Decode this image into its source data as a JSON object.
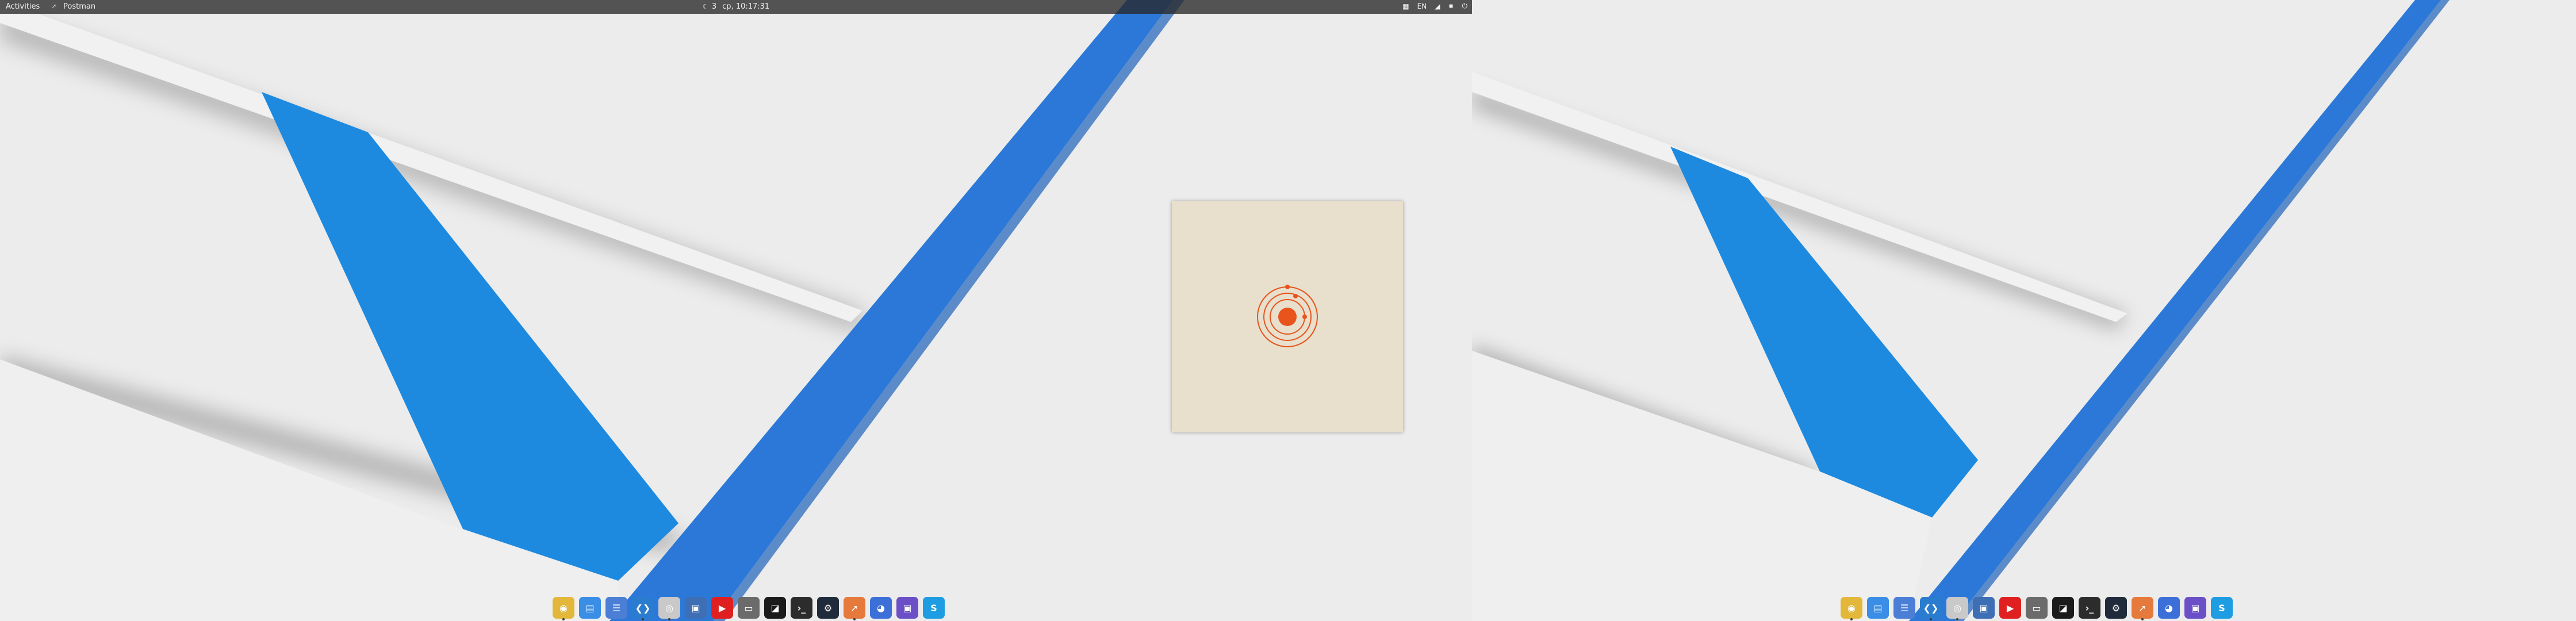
{
  "topbar": {
    "activities": "Activities",
    "app_name": "Postman",
    "status_count": "3",
    "clock": "ср, 10:17:31",
    "tray_icons": [
      "network-icon",
      "keyboard-layout-indicator",
      "volume-icon",
      "brightness-icon",
      "power-icon"
    ],
    "keyboard_layout": "EN"
  },
  "splash": {
    "app": "Postman",
    "background": "#e8dfcc",
    "accent": "#e8541c"
  },
  "wallpaper": {
    "background": "#ececec",
    "stripe_colors": [
      "#2b78d8",
      "#1d8ae0"
    ]
  },
  "dock_primary": [
    {
      "name": "Google Chrome",
      "icon": "chrome-icon",
      "glyph": "◉",
      "color": "#e3b83a",
      "running": true
    },
    {
      "name": "Files",
      "icon": "files-icon",
      "glyph": "▤",
      "color": "#3a8ee6",
      "running": false
    },
    {
      "name": "Text Editor",
      "icon": "text-editor-icon",
      "glyph": "☰",
      "color": "#4b7fd6",
      "running": false
    },
    {
      "name": "Visual Studio Code",
      "icon": "vscode-icon",
      "glyph": "❮❯",
      "color": "#2a7ccf",
      "running": true
    },
    {
      "name": "Disks",
      "icon": "disks-icon",
      "glyph": "◎",
      "color": "#c9c9c9",
      "running": true
    },
    {
      "name": "VirtualBox",
      "icon": "virtualbox-icon",
      "glyph": "▣",
      "color": "#3e6fb5",
      "running": false
    },
    {
      "name": "YouTube Music",
      "icon": "music-player-icon",
      "glyph": "▶",
      "color": "#e02020",
      "running": false
    },
    {
      "name": "Terminal Server",
      "icon": "remote-desktop-icon",
      "glyph": "▭",
      "color": "#6b6b6b",
      "running": false
    },
    {
      "name": "JetBrains Toolbox",
      "icon": "jetbrains-icon",
      "glyph": "◪",
      "color": "#1b1b1b",
      "running": false
    },
    {
      "name": "Terminal",
      "icon": "terminal-icon",
      "glyph": "›_",
      "color": "#2c2c2c",
      "running": false
    },
    {
      "name": "Steam",
      "icon": "steam-icon",
      "glyph": "⚙",
      "color": "#1f2b3a",
      "running": false
    },
    {
      "name": "Postman",
      "icon": "postman-icon",
      "glyph": "➚",
      "color": "#e6793c",
      "running": true
    },
    {
      "name": "Firefox",
      "icon": "firefox-icon",
      "glyph": "◕",
      "color": "#3d6fd8",
      "running": false
    },
    {
      "name": "Screenshot",
      "icon": "screenshot-icon",
      "glyph": "▣",
      "color": "#6b4fc7",
      "running": false
    },
    {
      "name": "Skype",
      "icon": "skype-icon",
      "glyph": "S",
      "color": "#1e9de2",
      "running": false
    }
  ],
  "dock_secondary": [
    {
      "name": "Google Chrome",
      "icon": "chrome-icon",
      "glyph": "◉",
      "color": "#e3b83a",
      "running": true
    },
    {
      "name": "Files",
      "icon": "files-icon",
      "glyph": "▤",
      "color": "#3a8ee6",
      "running": false
    },
    {
      "name": "Text Editor",
      "icon": "text-editor-icon",
      "glyph": "☰",
      "color": "#4b7fd6",
      "running": false
    },
    {
      "name": "Visual Studio Code",
      "icon": "vscode-icon",
      "glyph": "❮❯",
      "color": "#2a7ccf",
      "running": true
    },
    {
      "name": "Disks",
      "icon": "disks-icon",
      "glyph": "◎",
      "color": "#c9c9c9",
      "running": true
    },
    {
      "name": "VirtualBox",
      "icon": "virtualbox-icon",
      "glyph": "▣",
      "color": "#3e6fb5",
      "running": false
    },
    {
      "name": "YouTube Music",
      "icon": "music-player-icon",
      "glyph": "▶",
      "color": "#e02020",
      "running": false
    },
    {
      "name": "Terminal Server",
      "icon": "remote-desktop-icon",
      "glyph": "▭",
      "color": "#6b6b6b",
      "running": false
    },
    {
      "name": "JetBrains Toolbox",
      "icon": "jetbrains-icon",
      "glyph": "◪",
      "color": "#1b1b1b",
      "running": false
    },
    {
      "name": "Terminal",
      "icon": "terminal-icon",
      "glyph": "›_",
      "color": "#2c2c2c",
      "running": false
    },
    {
      "name": "Steam",
      "icon": "steam-icon",
      "glyph": "⚙",
      "color": "#1f2b3a",
      "running": false
    },
    {
      "name": "Postman",
      "icon": "postman-icon",
      "glyph": "➚",
      "color": "#e6793c",
      "running": true
    },
    {
      "name": "Firefox",
      "icon": "firefox-icon",
      "glyph": "◕",
      "color": "#3d6fd8",
      "running": false
    },
    {
      "name": "Screenshot",
      "icon": "screenshot-icon",
      "glyph": "▣",
      "color": "#6b4fc7",
      "running": false
    },
    {
      "name": "Skype",
      "icon": "skype-icon",
      "glyph": "S",
      "color": "#1e9de2",
      "running": false
    }
  ]
}
